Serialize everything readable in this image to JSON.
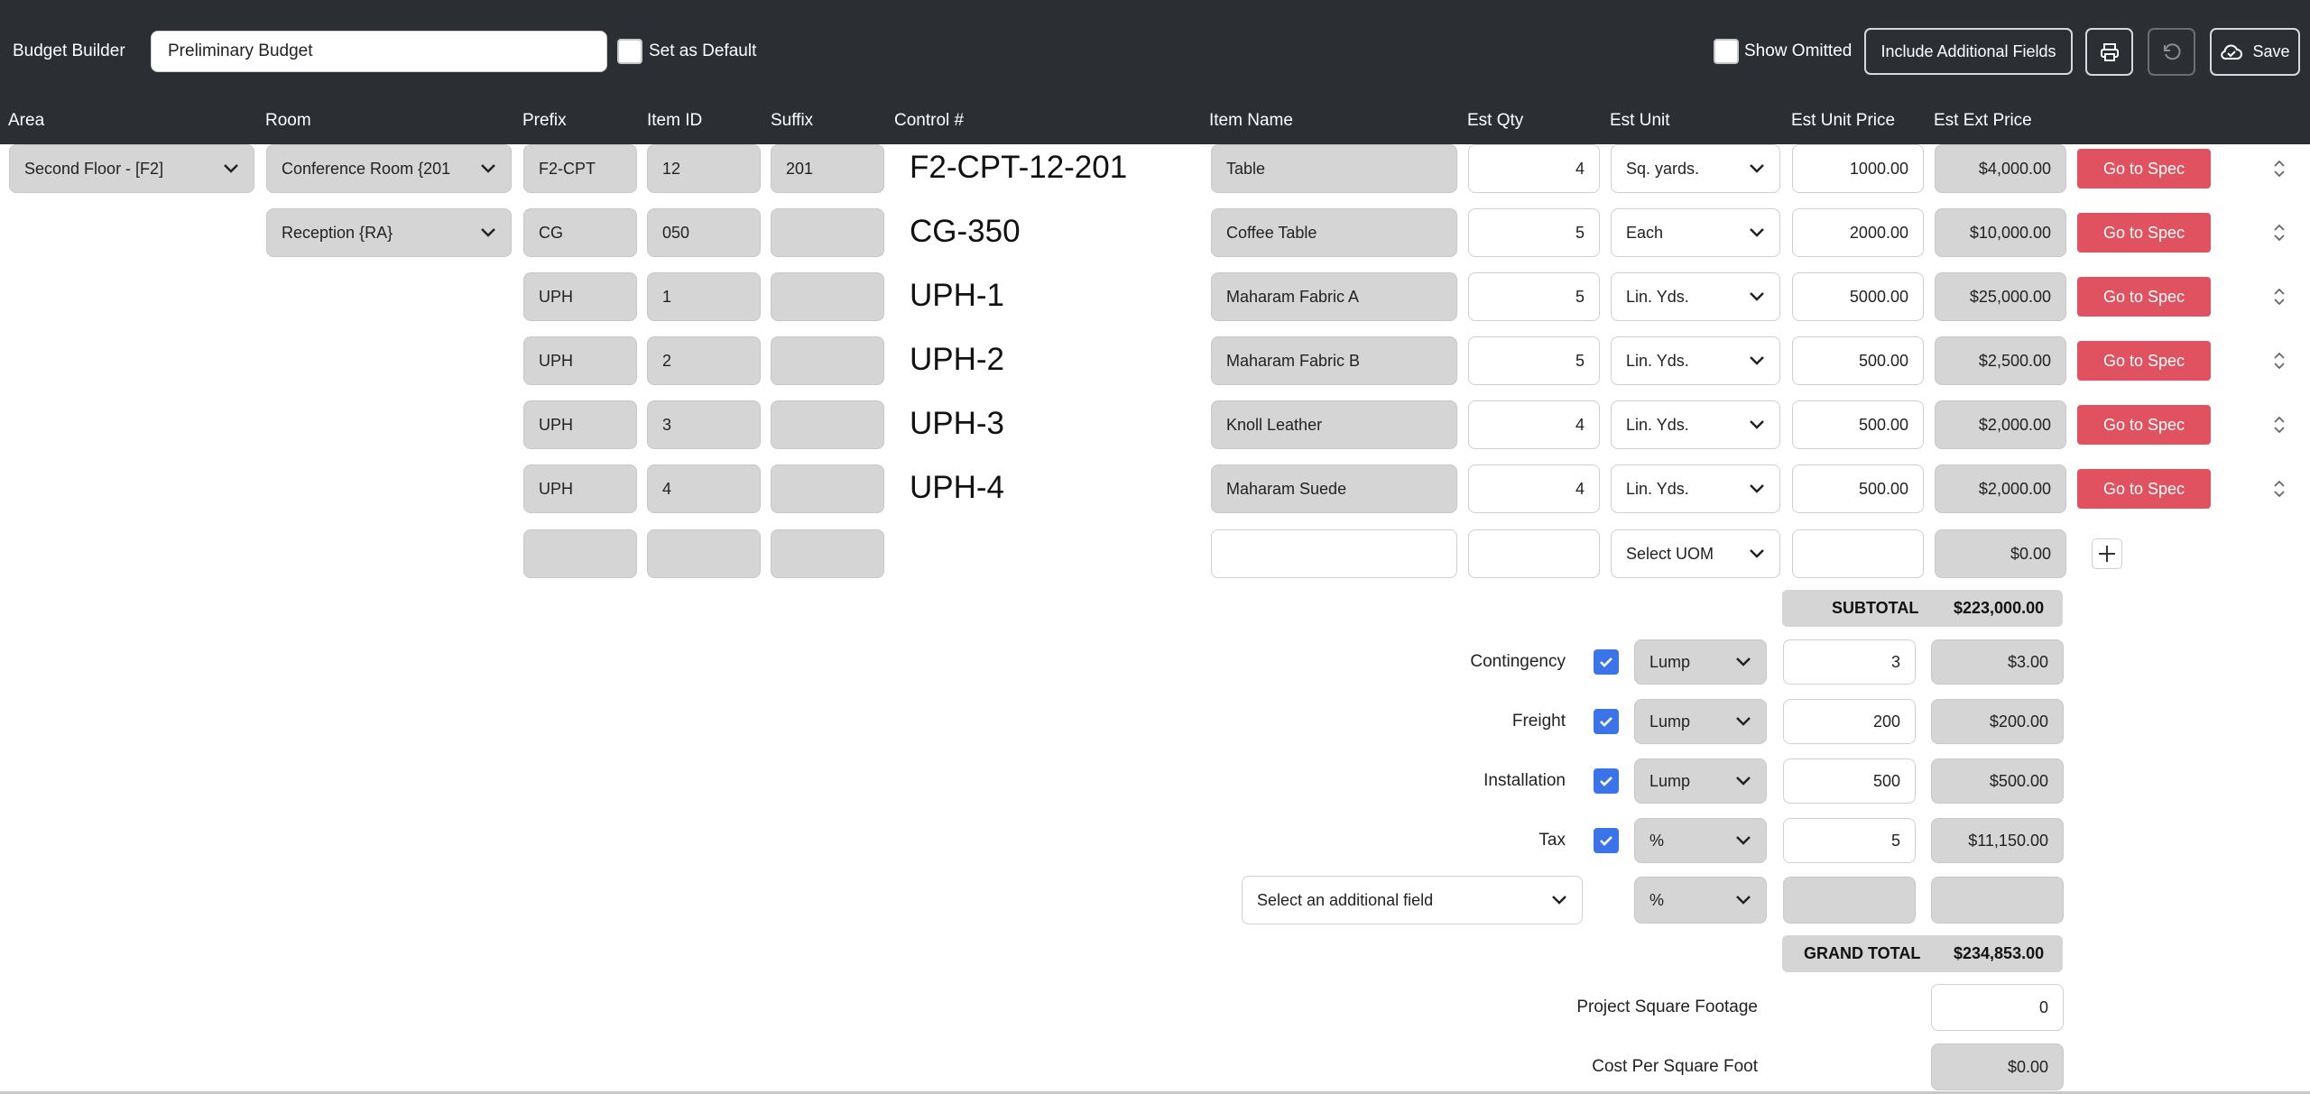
{
  "header": {
    "app_label": "Budget Builder",
    "budget_name": "Preliminary Budget",
    "set_default_label": "Set as Default",
    "show_omitted_label": "Show Omitted",
    "include_fields_label": "Include Additional Fields",
    "save_label": "Save",
    "icons": {
      "print": "printer-icon",
      "undo": "undo-icon",
      "save": "cloud-check-icon"
    }
  },
  "columns": {
    "area": "Area",
    "room": "Room",
    "prefix": "Prefix",
    "item_id": "Item ID",
    "suffix": "Suffix",
    "control": "Control #",
    "item_name": "Item Name",
    "est_qty": "Est Qty",
    "est_unit": "Est Unit",
    "est_unit_price": "Est Unit Price",
    "est_ext_price": "Est Ext Price"
  },
  "rows": [
    {
      "area": "Second Floor - [F2]",
      "room": "Conference Room {201",
      "prefix": "F2-CPT",
      "item_id": "12",
      "suffix": "201",
      "control": "F2-CPT-12-201",
      "item_name": "Table",
      "qty": "4",
      "unit": "Sq. yards.",
      "unit_price": "1000.00",
      "ext_price": "$4,000.00",
      "spec_label": "Go to Spec"
    },
    {
      "area": "",
      "room": "Reception {RA}",
      "prefix": "CG",
      "item_id": "050",
      "suffix": "",
      "control": "CG-350",
      "item_name": "Coffee Table",
      "qty": "5",
      "unit": "Each",
      "unit_price": "2000.00",
      "ext_price": "$10,000.00",
      "spec_label": "Go to Spec"
    },
    {
      "area": "",
      "room": "",
      "prefix": "UPH",
      "item_id": "1",
      "suffix": "",
      "control": "UPH-1",
      "item_name": "Maharam Fabric A",
      "qty": "5",
      "unit": "Lin. Yds.",
      "unit_price": "5000.00",
      "ext_price": "$25,000.00",
      "spec_label": "Go to Spec"
    },
    {
      "area": "",
      "room": "",
      "prefix": "UPH",
      "item_id": "2",
      "suffix": "",
      "control": "UPH-2",
      "item_name": "Maharam Fabric B",
      "qty": "5",
      "unit": "Lin. Yds.",
      "unit_price": "500.00",
      "ext_price": "$2,500.00",
      "spec_label": "Go to Spec"
    },
    {
      "area": "",
      "room": "",
      "prefix": "UPH",
      "item_id": "3",
      "suffix": "",
      "control": "UPH-3",
      "item_name": "Knoll Leather",
      "qty": "4",
      "unit": "Lin. Yds.",
      "unit_price": "500.00",
      "ext_price": "$2,000.00",
      "spec_label": "Go to Spec"
    },
    {
      "area": "",
      "room": "",
      "prefix": "UPH",
      "item_id": "4",
      "suffix": "",
      "control": "UPH-4",
      "item_name": "Maharam Suede",
      "qty": "4",
      "unit": "Lin. Yds.",
      "unit_price": "500.00",
      "ext_price": "$2,000.00",
      "spec_label": "Go to Spec"
    }
  ],
  "new_row": {
    "unit_placeholder": "Select UOM",
    "ext_price": "$0.00"
  },
  "subtotal": {
    "label": "SUBTOTAL",
    "value": "$223,000.00"
  },
  "adjustments": [
    {
      "label": "Contingency",
      "checked": true,
      "type": "Lump",
      "amount": "3",
      "total": "$3.00"
    },
    {
      "label": "Freight",
      "checked": true,
      "type": "Lump",
      "amount": "200",
      "total": "$200.00"
    },
    {
      "label": "Installation",
      "checked": true,
      "type": "Lump",
      "amount": "500",
      "total": "$500.00"
    },
    {
      "label": "Tax",
      "checked": true,
      "type": "%",
      "amount": "5",
      "total": "$11,150.00"
    }
  ],
  "additional_field": {
    "placeholder": "Select an additional field",
    "type": "%"
  },
  "grand_total": {
    "label": "GRAND TOTAL",
    "value": "$234,853.00"
  },
  "project_sqft": {
    "label": "Project Square Footage",
    "value": "0"
  },
  "cost_per_sqft": {
    "label": "Cost Per Square Foot",
    "value": "$0.00"
  },
  "colors": {
    "topbar": "#2b2f33",
    "spec_button": "#e0525f",
    "checkbox": "#3b73e8",
    "field_gray": "#d5d5d5"
  }
}
